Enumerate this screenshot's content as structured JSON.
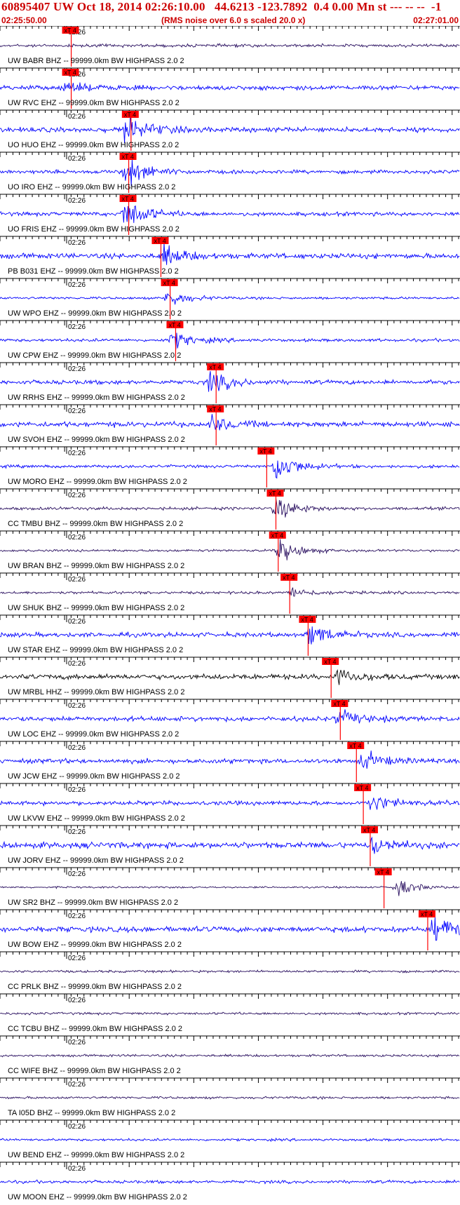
{
  "header": {
    "title": "60895407 UW Oct 18, 2014 02:26:10.00   44.6213 -123.7892  0.4 0.00 Mn st --- -- --  -1",
    "start_time": "02:25:50.00",
    "subtitle": "(RMS noise over 6.0 s scaled 20.0 x)",
    "end_time": "02:27:01.00"
  },
  "colors": {
    "background": "#ffffff",
    "text": "#000000",
    "header_text": "#cc0000",
    "pick_marker": "#ff0000",
    "blue_trace": "#0000ff",
    "purple_trace": "#2a1060",
    "black_trace": "#000000"
  },
  "chart_data": {
    "type": "line",
    "title": "60895407 UW Oct 18, 2014 02:26:10.00   44.6213 -123.7892  0.4 0.00 Mn st --- -- --  -1",
    "x_axis": {
      "start": "02:25:50.00",
      "end": "02:27:01.00",
      "minute_mark": "02:26"
    },
    "pick_label": "xT 4",
    "grid": false,
    "legend": "none",
    "series": [
      {
        "name": "UW BABR BHZ -- 99999.0km BW  HIGHPASS  2.0  2",
        "color": "purple",
        "pick_pct": 13.5,
        "event_pct": null,
        "event_amp": 0,
        "noise": 0.1
      },
      {
        "name": "UW RVC EHZ -- 99999.0km BW  HIGHPASS  2.0  2",
        "color": "blue",
        "pick_pct": 13.5,
        "event_pct": 14.5,
        "event_amp": 0.3,
        "noise": 0.15
      },
      {
        "name": "UO HUO EHZ -- 99999.0km BW  HIGHPASS  2.0  2",
        "color": "blue",
        "pick_pct": 26.5,
        "event_pct": 27.5,
        "event_amp": 1.0,
        "noise": 0.16
      },
      {
        "name": "UO IRO EHZ -- 99999.0km BW  HIGHPASS  2.0  2",
        "color": "blue",
        "pick_pct": 26.0,
        "event_pct": 27.2,
        "event_amp": 1.0,
        "noise": 0.12
      },
      {
        "name": "UO FRIS EHZ -- 99999.0km BW  HIGHPASS  2.0  2",
        "color": "blue",
        "pick_pct": 26.0,
        "event_pct": 27.2,
        "event_amp": 1.0,
        "noise": 0.13
      },
      {
        "name": "PB B031 EHZ -- 99999.0km BW  HIGHPASS  2.0  2",
        "color": "blue",
        "pick_pct": 33.0,
        "event_pct": 35.5,
        "event_amp": 0.65,
        "noise": 0.17
      },
      {
        "name": "UW WPO EHZ -- 99999.0km BW  HIGHPASS  2.0  2",
        "color": "blue",
        "pick_pct": 35.0,
        "event_pct": 36.3,
        "event_amp": 0.55,
        "noise": 0.08
      },
      {
        "name": "UW CPW EHZ -- 99999.0km BW  HIGHPASS  2.0  2",
        "color": "blue",
        "pick_pct": 36.2,
        "event_pct": 37.5,
        "event_amp": 0.55,
        "noise": 0.1
      },
      {
        "name": "UW RRHS EHZ -- 99999.0km BW  HIGHPASS  2.0  2",
        "color": "blue",
        "pick_pct": 45.0,
        "event_pct": 45.6,
        "event_amp": 0.65,
        "noise": 0.14
      },
      {
        "name": "UW SVOH EHZ -- 99999.0km BW  HIGHPASS  2.0  2",
        "color": "blue",
        "pick_pct": 45.0,
        "event_pct": 45.8,
        "event_amp": 0.5,
        "noise": 0.17
      },
      {
        "name": "UW MORO EHZ -- 99999.0km BW  HIGHPASS  2.0  2",
        "color": "blue",
        "pick_pct": 56.0,
        "event_pct": 60.0,
        "event_amp": 1.0,
        "noise": 0.1
      },
      {
        "name": "CC TMBU BHZ -- 99999.0km BW  HIGHPASS  2.0  2",
        "color": "purple",
        "pick_pct": 58.0,
        "event_pct": 60.0,
        "event_amp": 0.75,
        "noise": 0.1
      },
      {
        "name": "UW BRAN BHZ -- 99999.0km BW  HIGHPASS  2.0  2",
        "color": "purple",
        "pick_pct": 58.5,
        "event_pct": 60.6,
        "event_amp": 0.7,
        "noise": 0.08
      },
      {
        "name": "UW SHUK BHZ -- 99999.0km BW  HIGHPASS  2.0  2",
        "color": "purple",
        "pick_pct": 61.0,
        "event_pct": 63.5,
        "event_amp": 0.3,
        "noise": 0.09
      },
      {
        "name": "UW STAR EHZ -- 99999.0km BW  HIGHPASS  2.0  2",
        "color": "blue",
        "pick_pct": 65.0,
        "event_pct": 67.5,
        "event_amp": 0.7,
        "noise": 0.15
      },
      {
        "name": "UW MRBL HHZ -- 99999.0km BW  HIGHPASS  2.0  2",
        "color": "black",
        "pick_pct": 70.0,
        "event_pct": 73.5,
        "event_amp": 0.45,
        "noise": 0.17
      },
      {
        "name": "UW LOC EHZ -- 99999.0km BW  HIGHPASS  2.0  2",
        "color": "blue",
        "pick_pct": 72.0,
        "event_pct": 73.5,
        "event_amp": 0.5,
        "noise": 0.16
      },
      {
        "name": "UW JCW EHZ -- 99999.0km BW  HIGHPASS  2.0  2",
        "color": "blue",
        "pick_pct": 75.5,
        "event_pct": 79.0,
        "event_amp": 0.55,
        "noise": 0.15
      },
      {
        "name": "UW LKVW EHZ -- 99999.0km BW  HIGHPASS  2.0  2",
        "color": "blue",
        "pick_pct": 77.0,
        "event_pct": 80.5,
        "event_amp": 0.55,
        "noise": 0.14
      },
      {
        "name": "UW JORV EHZ -- 99999.0km BW  HIGHPASS  2.0  2",
        "color": "blue",
        "pick_pct": 78.5,
        "event_pct": 81.0,
        "event_amp": 0.5,
        "noise": 0.2
      },
      {
        "name": "UW SR2 BHZ -- 99999.0km BW  HIGHPASS  2.0  2",
        "color": "purple",
        "pick_pct": 81.5,
        "event_pct": 86.0,
        "event_amp": 0.55,
        "noise": 0.06
      },
      {
        "name": "UW BOW EHZ -- 99999.0km BW  HIGHPASS  2.0  2",
        "color": "blue",
        "pick_pct": 91.0,
        "event_pct": 94.5,
        "event_amp": 0.85,
        "noise": 0.18
      },
      {
        "name": "CC PRLK BHZ -- 99999.0km BW  HIGHPASS  2.0  2",
        "color": "purple",
        "pick_pct": null,
        "event_pct": null,
        "event_amp": 0,
        "noise": 0.08
      },
      {
        "name": "CC TCBU BHZ -- 99999.0km BW  HIGHPASS  2.0  2",
        "color": "purple",
        "pick_pct": null,
        "event_pct": null,
        "event_amp": 0,
        "noise": 0.08
      },
      {
        "name": "CC WIFE BHZ -- 99999.0km BW  HIGHPASS  2.0  2",
        "color": "purple",
        "pick_pct": null,
        "event_pct": null,
        "event_amp": 0,
        "noise": 0.08
      },
      {
        "name": "TA I05D BHZ -- 99999.0km BW  HIGHPASS  2.0  2",
        "color": "purple",
        "pick_pct": null,
        "event_pct": null,
        "event_amp": 0,
        "noise": 0.08
      },
      {
        "name": "UW BEND EHZ -- 99999.0km BW  HIGHPASS  2.0  2",
        "color": "blue",
        "pick_pct": null,
        "event_pct": null,
        "event_amp": 0,
        "noise": 0.08
      },
      {
        "name": "UW MOON EHZ -- 99999.0km BW  HIGHPASS  2.0  2",
        "color": "blue",
        "pick_pct": null,
        "event_pct": null,
        "event_amp": 0,
        "noise": 0.1
      }
    ]
  }
}
